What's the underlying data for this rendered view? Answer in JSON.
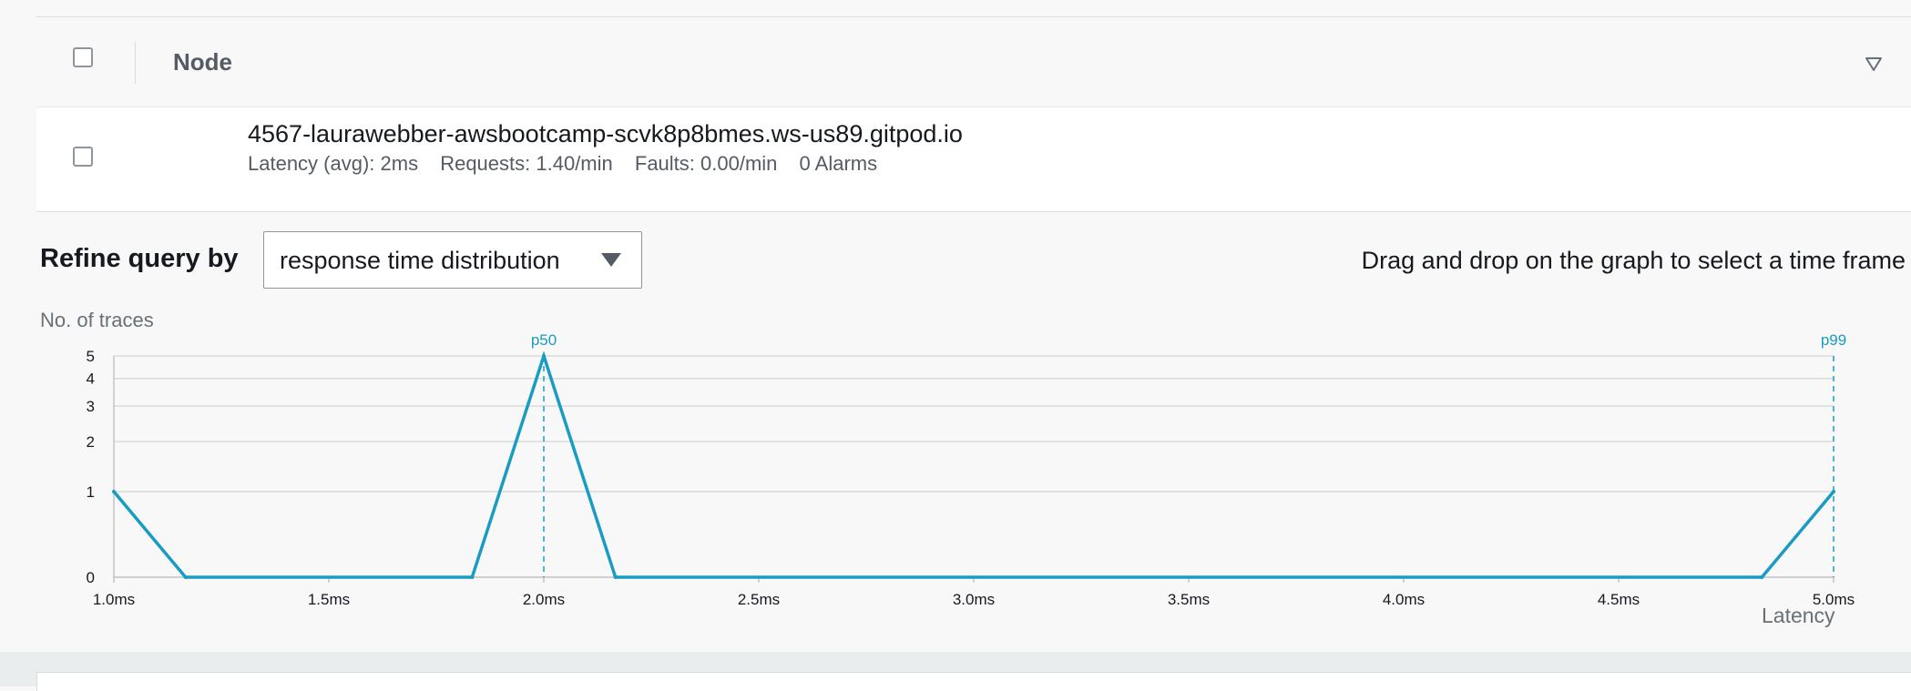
{
  "table": {
    "header": {
      "column_label": "Node"
    },
    "row": {
      "node_name": "4567-laurawebber-awsbootcamp-scvk8p8bmes.ws-us89.gitpod.io",
      "latency": "Latency (avg): 2ms",
      "requests": "Requests: 1.40/min",
      "faults": "Faults: 0.00/min",
      "alarms": "0 Alarms"
    }
  },
  "refine": {
    "label": "Refine query by",
    "selected": "response time distribution",
    "hint": "Drag and drop on the graph to select a time frame"
  },
  "colors": {
    "series": "#1a9cc2",
    "grid": "#d5d5d5"
  },
  "icons": {
    "sort": "sort-descending-icon",
    "caret": "caret-down-icon"
  },
  "chart_data": {
    "type": "line",
    "ylabel": "No. of traces",
    "xlabel": "Latency",
    "x_unit": "ms",
    "x": [
      1.0,
      1.1667,
      1.8333,
      2.0,
      2.1667,
      4.8333,
      5.0
    ],
    "values": [
      1,
      0,
      0,
      5,
      0,
      0,
      1
    ],
    "y_ticks": [
      0,
      1,
      2,
      3,
      4,
      5
    ],
    "x_ticks": [
      "1.0ms",
      "1.5ms",
      "2.0ms",
      "2.5ms",
      "3.0ms",
      "3.5ms",
      "4.0ms",
      "4.5ms",
      "5.0ms"
    ],
    "x_tick_values": [
      1.0,
      1.5,
      2.0,
      2.5,
      3.0,
      3.5,
      4.0,
      4.5,
      5.0
    ],
    "xlim": [
      1.0,
      5.0
    ],
    "ylim": [
      0,
      5
    ],
    "y_scale": "log(1+y)",
    "markers": [
      {
        "label": "p50",
        "x": 2.0
      },
      {
        "label": "p99",
        "x": 5.0
      }
    ],
    "grid": true
  }
}
